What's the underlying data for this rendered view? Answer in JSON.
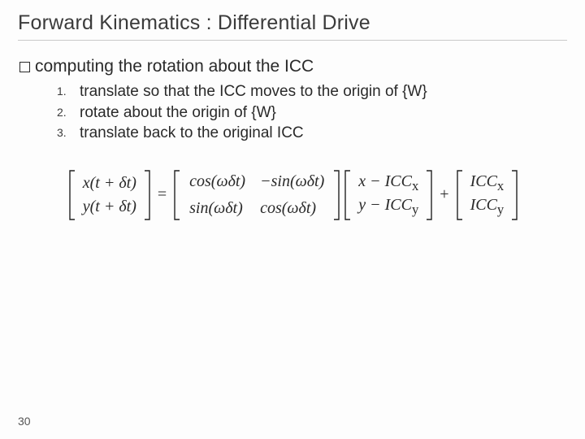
{
  "title": "Forward Kinematics : Differential Drive",
  "bullet": "computing the rotation about the ICC",
  "steps": [
    "translate so that the ICC moves to the origin of {W}",
    "rotate about the origin of {W}",
    "translate back to the original ICC"
  ],
  "equation": {
    "lhs": {
      "row1": "x(t + δt)",
      "row2": "y(t + δt)"
    },
    "eq": "=",
    "rot": {
      "r1c1": "cos(ωδt)",
      "r1c2": "−sin(ωδt)",
      "r2c1": "sin(ωδt)",
      "r2c2": "cos(ωδt)"
    },
    "vec": {
      "row1": "x − ICC",
      "row1_sub": "x",
      "row2": "y − ICC",
      "row2_sub": "y"
    },
    "plus": "+",
    "icc": {
      "row1": "ICC",
      "row1_sub": "x",
      "row2": "ICC",
      "row2_sub": "y"
    }
  },
  "page_number": "30"
}
